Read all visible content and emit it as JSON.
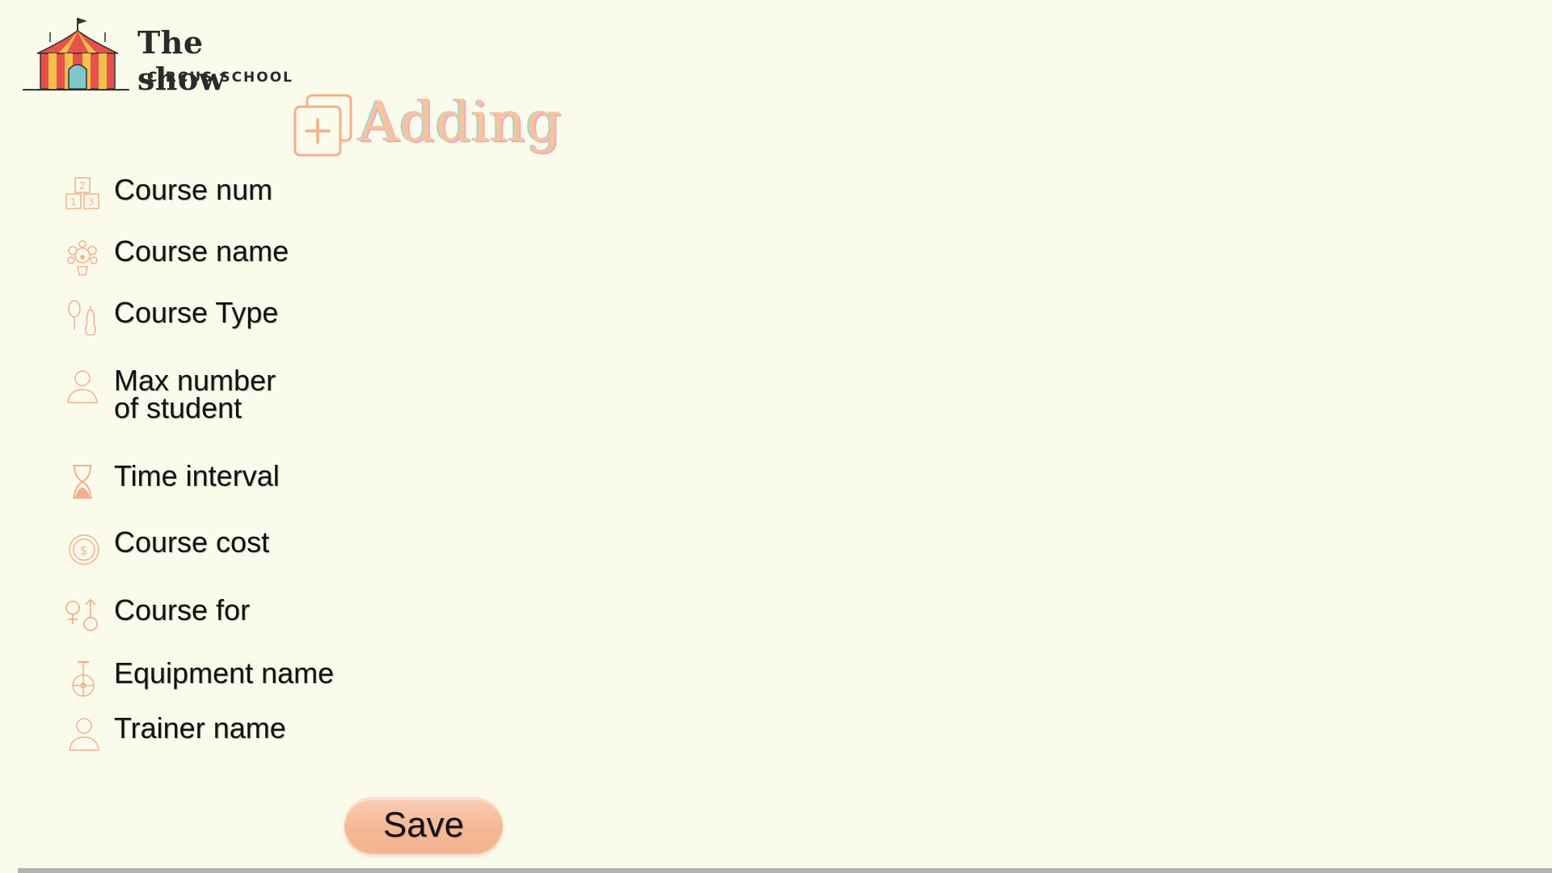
{
  "brand": {
    "title": "The show",
    "subtitle": "CIRCUS SCHOOL",
    "logo_icon": "circus-tent-icon"
  },
  "heading": {
    "text": "Adding",
    "icon": "add-square-icon",
    "colors": {
      "fill": "#f6c49c",
      "shadow_pink": "#f3a9c4",
      "shadow_teal": "#9fdad0"
    }
  },
  "fields": [
    {
      "label": "Course num",
      "icon": "number-blocks-icon"
    },
    {
      "label": "Course name",
      "icon": "clown-icon"
    },
    {
      "label": "Course Type",
      "icon": "juggling-pins-icon"
    },
    {
      "label": "Max number\nof student",
      "icon": "person-icon"
    },
    {
      "label": "Time interval",
      "icon": "hourglass-icon"
    },
    {
      "label": "Course cost",
      "icon": "dollar-coin-icon"
    },
    {
      "label": "Course for",
      "icon": "gender-icon"
    },
    {
      "label": "Equipment name",
      "icon": "unicycle-icon"
    },
    {
      "label": "Trainer name",
      "icon": "person-icon"
    }
  ],
  "actions": {
    "save_label": "Save"
  },
  "colors": {
    "background": "#fbfbec",
    "accent": "#f4b08a",
    "icon_stroke": "#f2b08f"
  }
}
